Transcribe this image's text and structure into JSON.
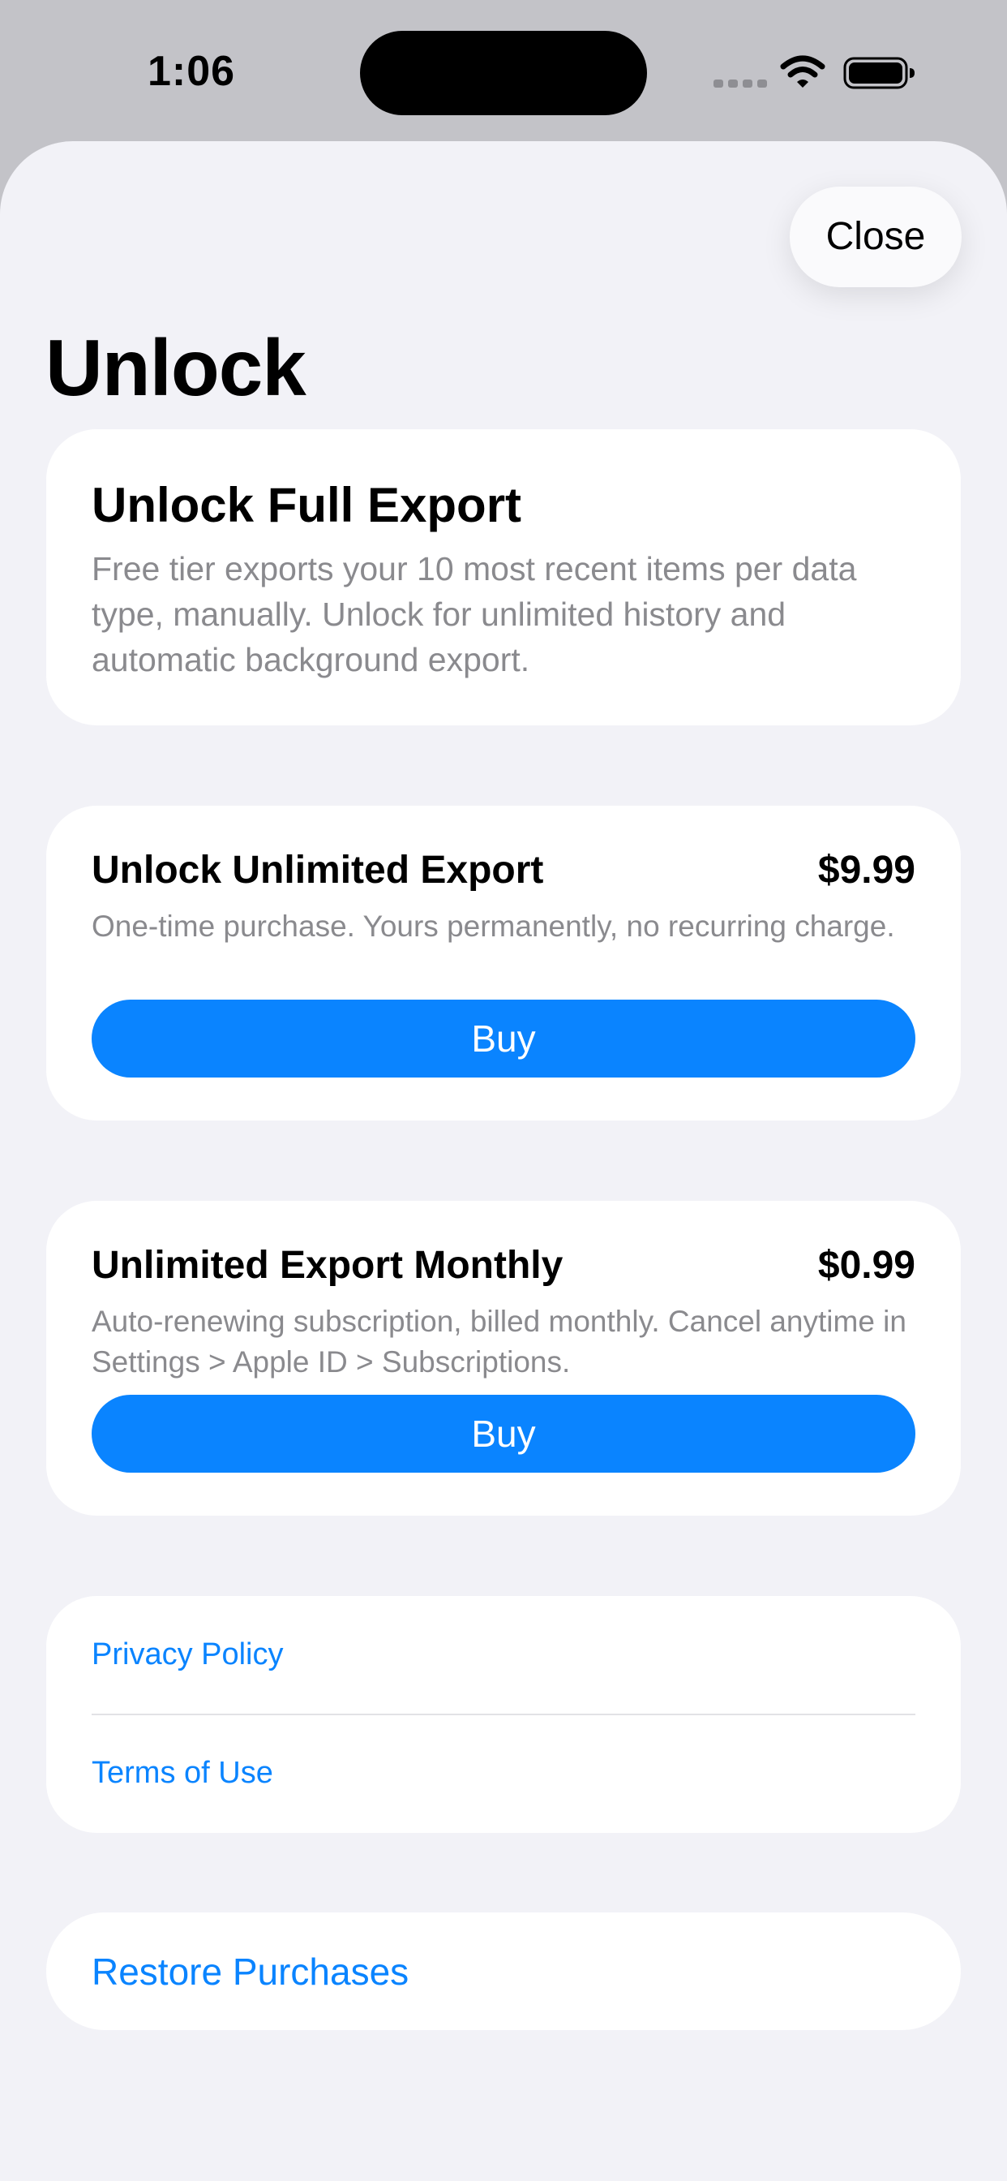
{
  "status_bar": {
    "time": "1:06",
    "icons": [
      "signal-dots-icon",
      "wifi-icon",
      "battery-icon"
    ]
  },
  "header": {
    "close_label": "Close",
    "title": "Unlock"
  },
  "intro": {
    "title": "Unlock Full Export",
    "description": "Free tier exports your 10 most recent items per data type, manually. Unlock for unlimited history and automatic background export."
  },
  "products": [
    {
      "name": "Unlock Unlimited Export",
      "price": "$9.99",
      "description": "One-time purchase. Yours permanently, no recurring charge.",
      "button_label": "Buy"
    },
    {
      "name": "Unlimited Export Monthly",
      "price": "$0.99",
      "description": "Auto-renewing subscription, billed monthly. Cancel anytime in Settings > Apple ID > Subscriptions.",
      "button_label": "Buy"
    }
  ],
  "links": {
    "privacy_policy": "Privacy Policy",
    "terms_of_use": "Terms of Use"
  },
  "restore": {
    "label": "Restore Purchases"
  },
  "colors": {
    "accent": "#0a84ff",
    "sheet_background": "#f2f2f7",
    "card_background": "#ffffff",
    "secondary_text": "#8a8a8e",
    "status_background": "#c3c3c8"
  }
}
